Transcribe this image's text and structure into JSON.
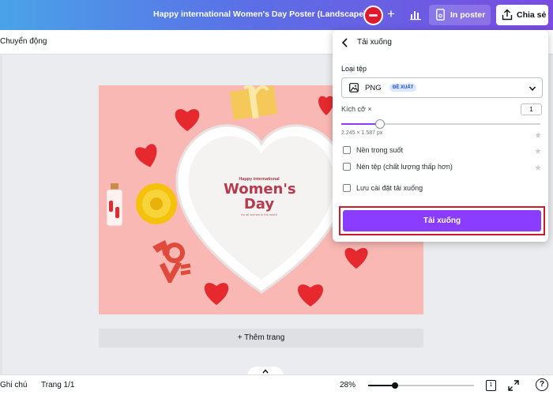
{
  "header": {
    "doc_title": "Happy international Women's  Day Poster (Landscape))",
    "print_label": "In poster",
    "share_label": "Chia sẻ",
    "brand_color": "#7a4ce0"
  },
  "toolbar": {
    "animate_label": "Chuyển động"
  },
  "design": {
    "card_subtitle": "Happy international",
    "card_title_line1": "Women's",
    "card_title_line2": "Day",
    "card_tagline": "for all women in the world",
    "background_color": "#f9b8b4"
  },
  "add_page_label": "+ Thêm trang",
  "panel": {
    "title": "Tải xuống",
    "file_type_label": "Loại tệp",
    "file_type_value": "PNG",
    "file_type_badge": "ĐỀ XUẤT",
    "size_label": "Kích cỡ ×",
    "size_value": "1",
    "size_slider_fraction": 0.19,
    "dimensions": "2.245 × 1.587 px",
    "options": [
      {
        "label": "Nền trong suốt",
        "checked": false
      },
      {
        "label": "Nén tệp (chất lượng thấp hơn)",
        "checked": false
      },
      {
        "label": "Lưu cài đặt tải xuống",
        "checked": false
      }
    ],
    "download_label": "Tải xuống",
    "accent_color": "#8b3dff",
    "highlight_color": "#cc1b2e"
  },
  "footer": {
    "notes_label": "Ghi chú",
    "page_indicator": "Trang 1/1",
    "zoom": "28%",
    "zoom_fraction": 0.25,
    "page_count": "1",
    "help_label": "?"
  },
  "icons": [
    "avatar",
    "plus-icon",
    "chart-icon",
    "print-icon",
    "share-icon",
    "back-icon",
    "image-icon",
    "chevron-down-icon",
    "pro-star-icon",
    "chevron-up-icon",
    "page-grid-icon",
    "fullscreen-icon",
    "help-icon"
  ]
}
